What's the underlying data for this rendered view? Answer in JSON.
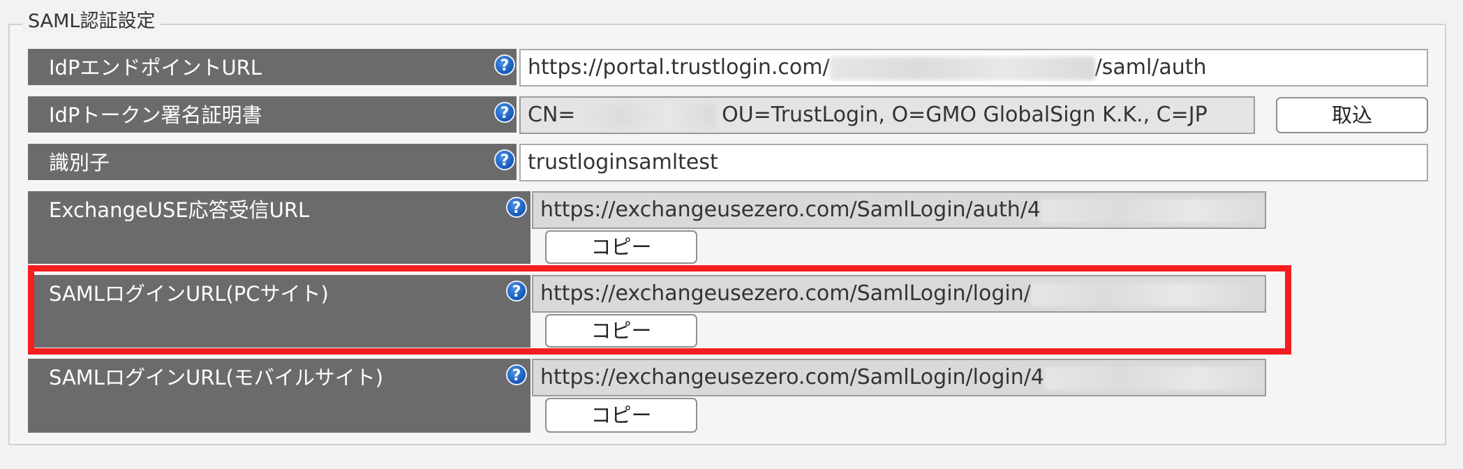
{
  "section": {
    "legend": "SAML認証設定"
  },
  "rows": {
    "idp_endpoint": {
      "label": "IdPエンドポイントURL",
      "value_prefix": "https://portal.trustlogin.com/",
      "value_suffix": "/saml/auth"
    },
    "idp_cert": {
      "label": "IdPトークン署名証明書",
      "value_prefix": "CN=",
      "value_suffix": "OU=TrustLogin, O=GMO GlobalSign K.K., C=JP",
      "button": "取込"
    },
    "identifier": {
      "label": "識別子",
      "value": "trustloginsamltest"
    },
    "acs_url": {
      "label": "ExchangeUSE応答受信URL",
      "value_prefix": "https://exchangeusezero.com/SamlLogin/auth/4",
      "button": "コピー"
    },
    "login_pc": {
      "label": "SAMLログインURL(PCサイト)",
      "value_prefix": "https://exchangeusezero.com/SamlLogin/login/",
      "button": "コピー"
    },
    "login_mobile": {
      "label": "SAMLログインURL(モバイルサイト)",
      "value_prefix": "https://exchangeusezero.com/SamlLogin/login/4",
      "button": "コピー"
    }
  },
  "help_glyph": "?",
  "icons": {
    "help": "help-circle-icon"
  },
  "colors": {
    "label_bg": "#6b6b6b",
    "help_blue": "#1c5fbf",
    "highlight": "#f41e1e"
  }
}
